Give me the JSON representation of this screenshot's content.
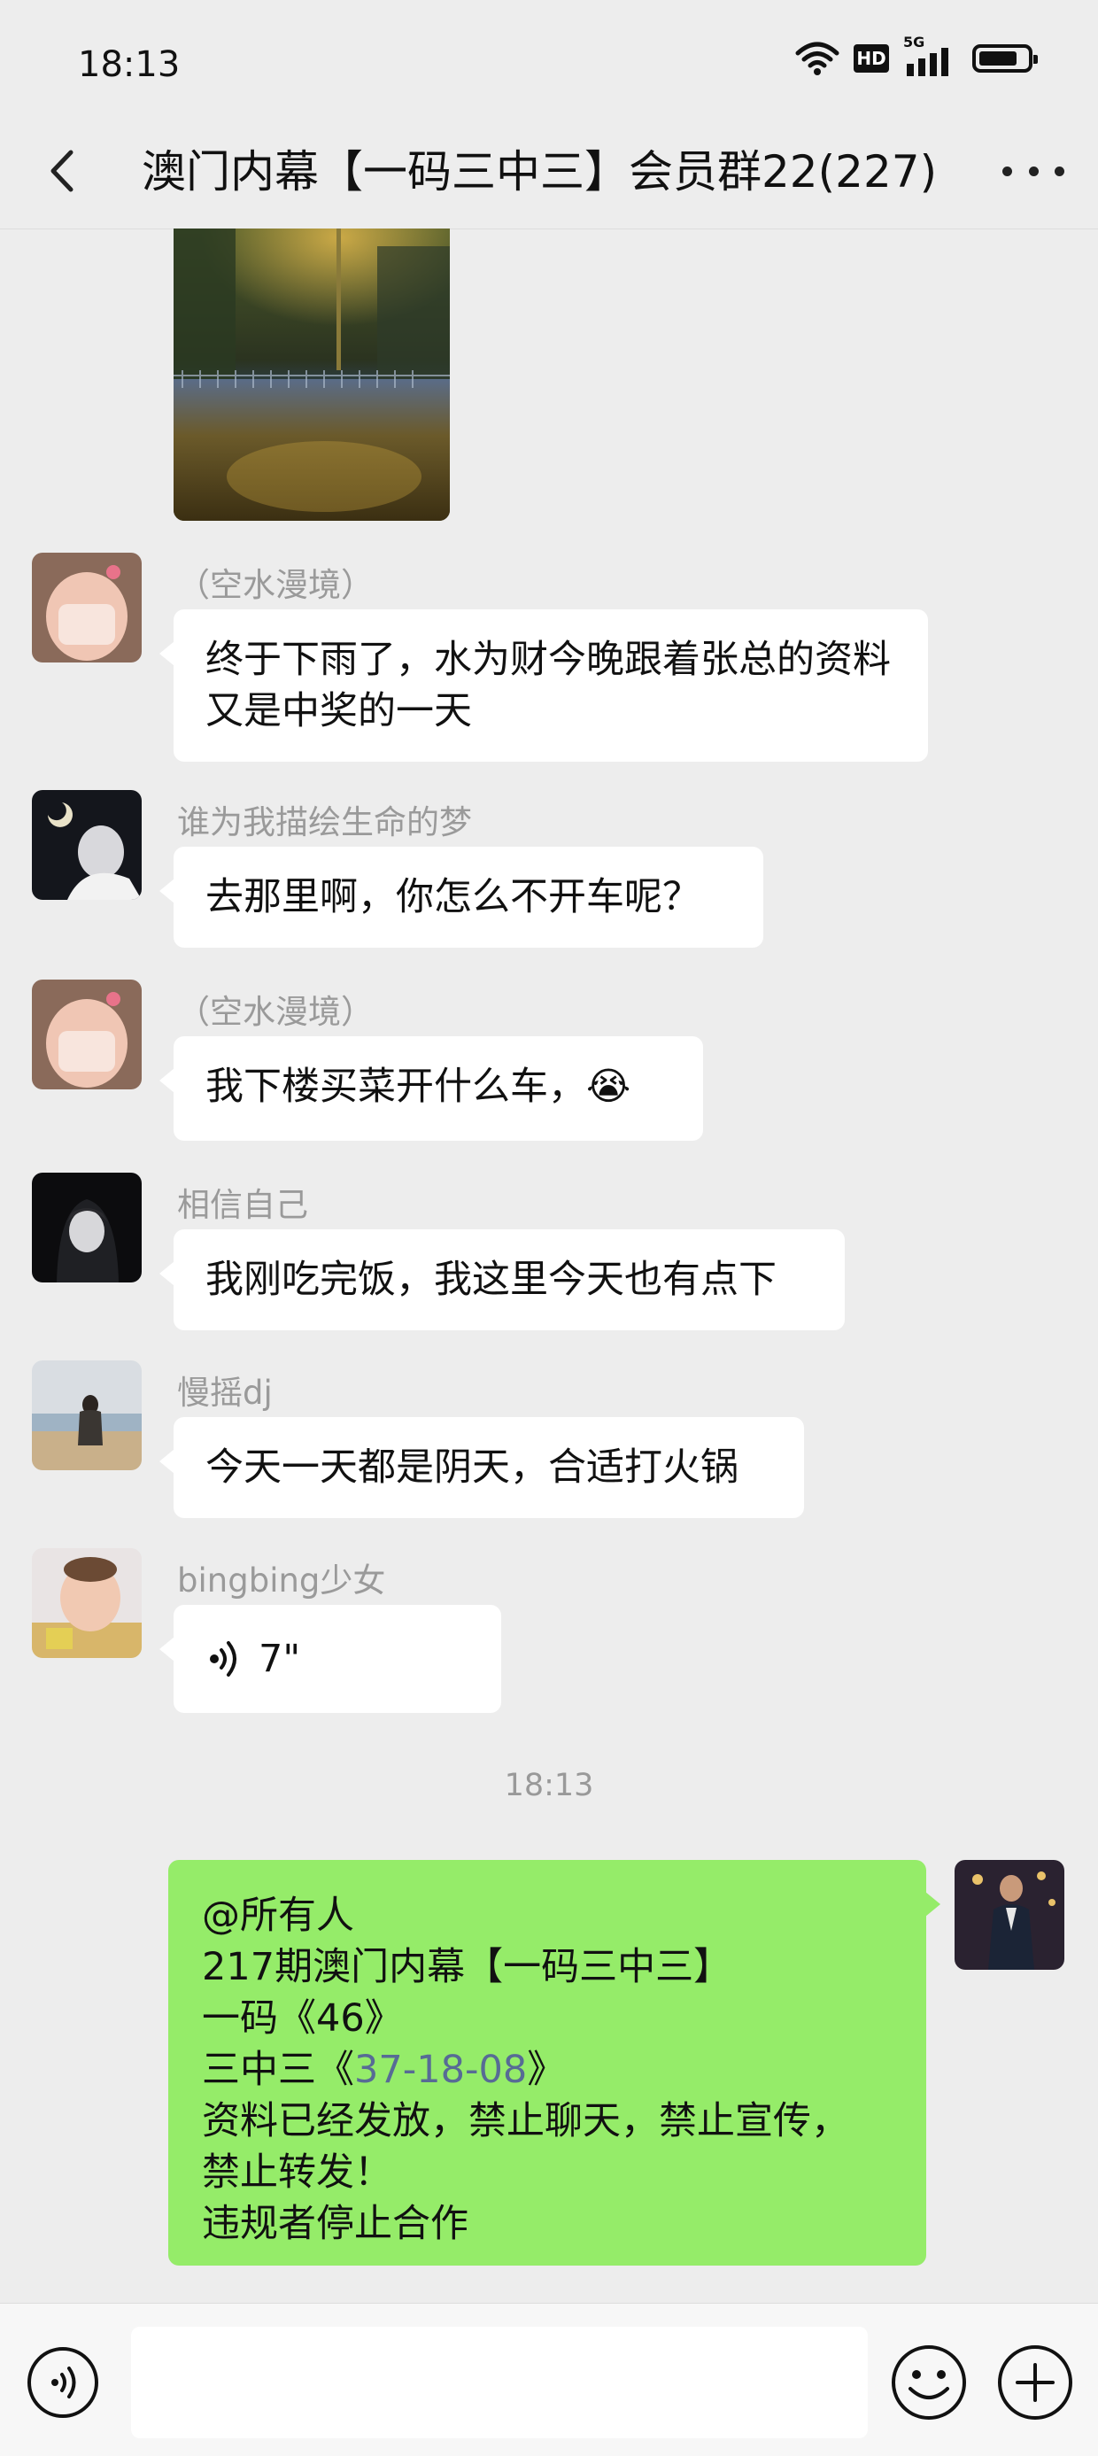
{
  "status_bar": {
    "time": "18:13",
    "hd_label": "HD",
    "network_label": "5G"
  },
  "header": {
    "title": "澳门内幕【一码三中三】会员群22(227)"
  },
  "messages": [
    {
      "sender": "（空水漫境）",
      "text": "终于下雨了，水为财今晚跟着张总的资料又是中奖的一天"
    },
    {
      "sender": "谁为我描绘生命的梦",
      "text": "去那里啊，你怎么不开车呢？"
    },
    {
      "sender": "（空水漫境）",
      "text": "我下楼买菜开什么车，",
      "emoji": "😭"
    },
    {
      "sender": "相信自己",
      "text": "我刚吃完饭，我这里今天也有点下"
    },
    {
      "sender": "慢摇dj",
      "text": "今天一天都是阴天，合适打火锅"
    },
    {
      "sender": "bingbing少女",
      "voice_duration": "7\""
    }
  ],
  "time_separator": "18:13",
  "my_message": {
    "line1": "@所有人",
    "line2": "217期澳门内幕【一码三中三】",
    "line3": "一码《46》",
    "line4_prefix": "三中三《",
    "line4_highlight": "37-18-08",
    "line4_suffix": "》",
    "line5": "资料已经发放，禁止聊天，禁止宣传，",
    "line6": "禁止转发！",
    "line7": "违规者停止合作"
  },
  "icons": {
    "back": "chevron-left-icon",
    "more": "more-dots-icon",
    "voice": "voice-icon",
    "emoji": "smiley-icon",
    "plus": "plus-circle-icon"
  },
  "colors": {
    "background": "#ededed",
    "bubble_mine": "#95ec69",
    "bubble_other": "#ffffff",
    "link": "#576b95"
  }
}
